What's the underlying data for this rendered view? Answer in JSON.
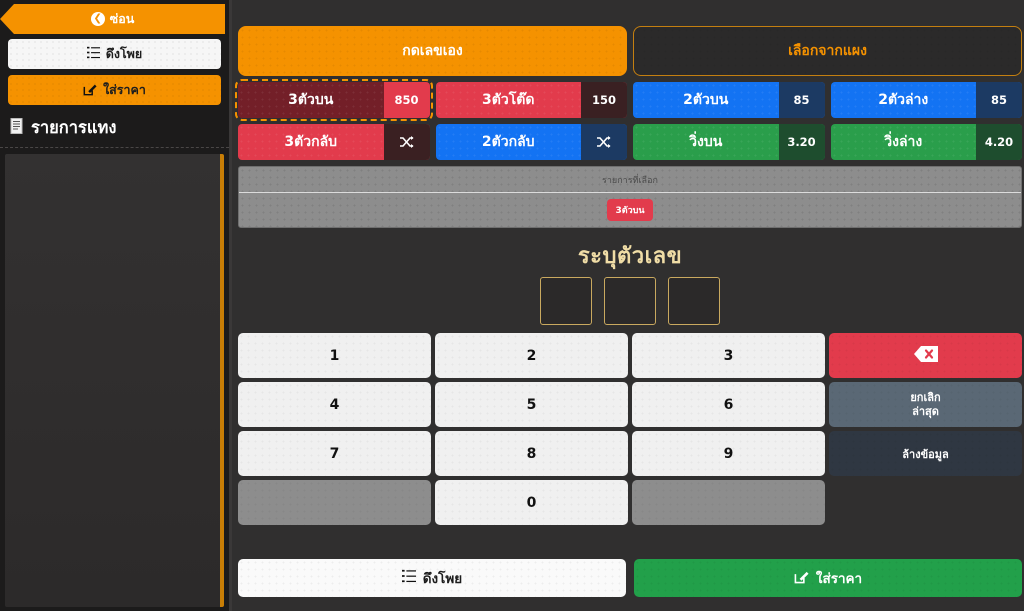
{
  "sidebar": {
    "hide_button": {
      "label": "ซ่อน",
      "icon": "chevron-left-circle-icon"
    },
    "buttons": [
      {
        "label": "ดึงโพย",
        "icon": "list-icon",
        "style": "white"
      },
      {
        "label": "ใส่ราคา",
        "icon": "edit-square-icon",
        "style": "orange"
      }
    ],
    "list_title": {
      "label": "รายการแทง",
      "icon": "receipt-icon"
    },
    "list_items": []
  },
  "main": {
    "tabs": [
      {
        "label": "กดเลขเอง",
        "active": true
      },
      {
        "label": "เลือกจากแผง",
        "active": false
      }
    ],
    "bet_types": [
      {
        "label": "3ตัวบน",
        "value": "850",
        "color": "red",
        "selected": true
      },
      {
        "label": "3ตัวโต๊ด",
        "value": "150",
        "color": "red",
        "selected": false
      },
      {
        "label": "2ตัวบน",
        "value": "85",
        "color": "blue",
        "selected": false
      },
      {
        "label": "2ตัวล่าง",
        "value": "85",
        "color": "blue",
        "selected": false
      },
      {
        "label": "3ตัวกลับ",
        "value": "shuffle-icon",
        "color": "red",
        "selected": false
      },
      {
        "label": "2ตัวกลับ",
        "value": "shuffle-icon",
        "color": "blue",
        "selected": false
      },
      {
        "label": "วิ่งบน",
        "value": "3.20",
        "color": "green",
        "selected": false
      },
      {
        "label": "วิ่งล่าง",
        "value": "4.20",
        "color": "green",
        "selected": false
      }
    ],
    "selected_panel": {
      "header": "รายการที่เลือก",
      "chips": [
        "3ตัวบน"
      ]
    },
    "entry": {
      "title": "ระบุตัวเลข",
      "digits": [
        "",
        "",
        ""
      ]
    },
    "keypad": [
      {
        "label": "1",
        "type": "num"
      },
      {
        "label": "2",
        "type": "num"
      },
      {
        "label": "3",
        "type": "num"
      },
      {
        "label": "",
        "type": "del",
        "icon": "backspace-icon"
      },
      {
        "label": "4",
        "type": "num"
      },
      {
        "label": "5",
        "type": "num"
      },
      {
        "label": "6",
        "type": "num"
      },
      {
        "label": "ยกเลิก\nล่าสุด",
        "type": "undo",
        "line1": "ยกเลิก",
        "line2": "ล่าสุด"
      },
      {
        "label": "7",
        "type": "num"
      },
      {
        "label": "8",
        "type": "num"
      },
      {
        "label": "9",
        "type": "num"
      },
      {
        "label": "ล้างข้อมูล",
        "type": "clear"
      },
      {
        "label": "",
        "type": "blank"
      },
      {
        "label": "0",
        "type": "num"
      },
      {
        "label": "",
        "type": "blank"
      },
      {
        "label": "",
        "type": "empty"
      }
    ],
    "footer": [
      {
        "label": "ดึงโพย",
        "icon": "list-icon",
        "style": "white"
      },
      {
        "label": "ใส่ราคา",
        "icon": "edit-square-icon",
        "style": "green"
      }
    ]
  },
  "colors": {
    "accent_orange": "#f59200",
    "red": "#e23b4c",
    "blue": "#1373f3",
    "green": "#2a9e4b",
    "background": "#302f2f",
    "sidebar_bg": "#1c1b1b",
    "gold_border": "#c9a95f"
  }
}
